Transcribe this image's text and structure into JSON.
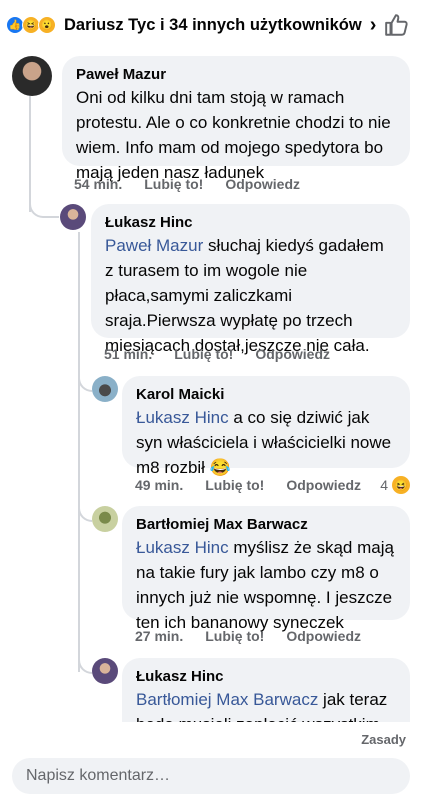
{
  "header": {
    "title": "Dariusz Tyc i 34 innych użytkowników",
    "reactions": [
      "like-icon",
      "haha-icon",
      "wow-icon"
    ]
  },
  "comments": [
    {
      "author": "Paweł Mazur",
      "text": "Oni od kilku dni tam stoją w ramach protestu. Ale o co konkretnie chodzi to nie wiem. Info mam od mojego spedytora bo mają jeden nasz ładunek",
      "time": "54 min.",
      "like": "Lubię to!",
      "reply": "Odpowiedz"
    },
    {
      "author": "Łukasz Hinc",
      "mention": "Paweł Mazur",
      "text": " słuchaj kiedyś gadałem z turasem to im wogole nie płaca,samymi zaliczkami sraja.Pierwsza wypłatę po trzech miesiącach dostał,jeszcze nie cała.",
      "time": "51 min.",
      "like": "Lubię to!",
      "reply": "Odpowiedz"
    },
    {
      "author": "Karol Maicki",
      "mention": "Łukasz Hinc",
      "text": " a co się dziwić jak syn właściciela i właścicielki nowe m8 rozbił",
      "emoji": "😂",
      "time": "49 min.",
      "like": "Lubię to!",
      "reply": "Odpowiedz",
      "reaction_count": "4"
    },
    {
      "author": "Bartłomiej Max Barwacz",
      "mention": "Łukasz Hinc",
      "text": " myślisz że skąd mają na takie fury jak lambo czy m8 o innych już nie wspomnę. I jeszcze ten ich bananowy syneczek",
      "time": "27 min.",
      "like": "Lubię to!",
      "reply": "Odpowiedz"
    },
    {
      "author": "Łukasz Hinc",
      "mention": "Bartłomiej Max Barwacz",
      "text": " jak teraz beda musieli zapłacić wszystkim"
    }
  ],
  "sort_label": "Zasady",
  "composer": {
    "placeholder": "Napisz komentarz…"
  },
  "colors": {
    "mention": "#385898",
    "bubble": "#f0f2f5",
    "meta": "#65676b"
  }
}
